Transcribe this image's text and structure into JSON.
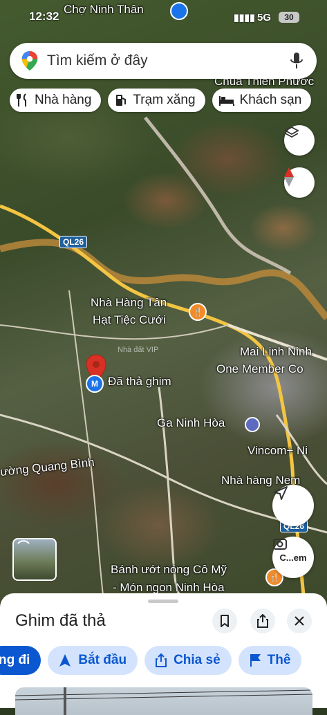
{
  "status_bar": {
    "time": "12:32",
    "network": "5G",
    "battery": "30"
  },
  "search": {
    "placeholder": "Tìm kiếm ở đây"
  },
  "chips": [
    {
      "label": "Nhà hàng",
      "icon": "fork-knife-icon"
    },
    {
      "label": "Trạm xăng",
      "icon": "gas-pump-icon"
    },
    {
      "label": "Khách sạn",
      "icon": "bed-icon"
    }
  ],
  "map_labels": {
    "cho_ninh_than": "Chợ Ninh Thân",
    "chua_thien_phuoc": "Chùa Thiên Phước",
    "road_shield_1": "QL26",
    "road_shield_2": "QL26",
    "nha_hang_tan_line1": "Nhà Hàng Tân",
    "nha_hang_tan_line2": "Hạt Tiệc Cưới",
    "mai_linh_line1": "Mai Linh Ninh",
    "mai_linh_line2": "One Member Co",
    "dropped_pin": "Đã thả ghim",
    "ga_ninh_hoa": "Ga Ninh Hòa",
    "vincom": "Vincom+ Ni",
    "quang_binh": "ường Quang Bình",
    "nha_hang_nem": "Nhà hàng Nem",
    "banh_uot_line1": "Bánh ướt nóng Cô Mỹ",
    "banh_uot_line2": "- Món ngon Ninh Hòa",
    "watermark": "Nhà đất VIP"
  },
  "lens_button_label": "C...em",
  "sheet": {
    "title": "Ghim đã thả",
    "actions": [
      {
        "label": "ng đi",
        "icon": "directions-icon"
      },
      {
        "label": "Bắt đầu",
        "icon": "navigation-arrow-icon"
      },
      {
        "label": "Chia sẻ",
        "icon": "share-icon"
      },
      {
        "label": "Thê",
        "icon": "flag-icon"
      }
    ]
  },
  "colors": {
    "accent_blue": "#0b57d0",
    "pin_red": "#d93025",
    "road_yellow": "#f4c542",
    "poi_orange": "#f28b29"
  }
}
